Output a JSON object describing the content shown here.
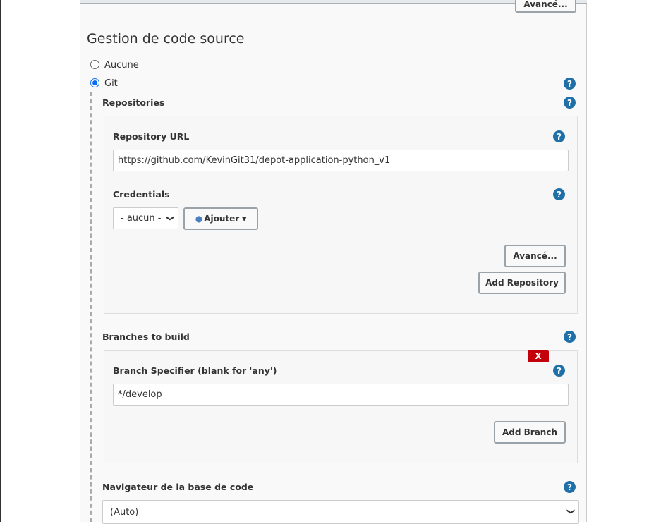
{
  "top_button": "Avancé...",
  "section_title": "Gestion de code source",
  "scm_options": [
    {
      "label": "Aucune",
      "selected": false
    },
    {
      "label": "Git",
      "selected": true
    }
  ],
  "repositories": {
    "label": "Repositories",
    "url_label": "Repository URL",
    "url_value": "https://github.com/KevinGit31/depot-application-python_v1",
    "credentials_label": "Credentials",
    "credentials_value": "- aucun -",
    "add_button": "Ajouter",
    "advanced_button": "Avancé...",
    "add_repository_button": "Add Repository"
  },
  "branches": {
    "label": "Branches to build",
    "delete_label": "X",
    "specifier_label": "Branch Specifier (blank for 'any')",
    "specifier_value": "*/develop",
    "add_branch_button": "Add Branch"
  },
  "browser": {
    "label": "Navigateur de la base de code",
    "value": "(Auto)"
  },
  "help_glyph": "?",
  "colors": {
    "help": "#1f6fa8",
    "delete": "#c4000a",
    "radio": "#0b6ef0"
  }
}
